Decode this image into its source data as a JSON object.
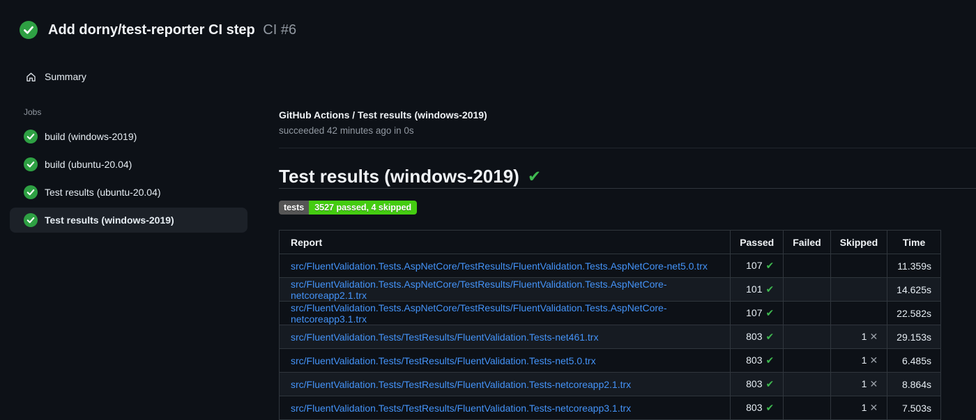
{
  "icons": {
    "check": "✔",
    "cross": "✕"
  },
  "colors": {
    "background": "#0d1117",
    "success_green": "#2ea043",
    "check_green": "#3fb950",
    "link_blue": "#4493f8",
    "muted_text": "#9198a1",
    "badge_label_bg": "#555555",
    "badge_value_bg": "#44cc11",
    "selected_item_bg": "#1c2128",
    "table_border": "#30363d",
    "row_stripe": "#161b22"
  },
  "header": {
    "title": "Add dorny/test-reporter CI step",
    "run_number": "CI #6",
    "status": "success"
  },
  "sidebar": {
    "summary_label": "Summary",
    "jobs_label": "Jobs",
    "jobs": [
      {
        "label": "build (windows-2019)",
        "status": "success",
        "selected": false
      },
      {
        "label": "build (ubuntu-20.04)",
        "status": "success",
        "selected": false
      },
      {
        "label": "Test results (ubuntu-20.04)",
        "status": "success",
        "selected": false
      },
      {
        "label": "Test results (windows-2019)",
        "status": "success",
        "selected": true
      }
    ]
  },
  "main": {
    "check_title": "GitHub Actions / Test results (windows-2019)",
    "check_subtitle": "succeeded 42 minutes ago in 0s",
    "section_title": "Test results (windows-2019)",
    "badge": {
      "label": "tests",
      "message": "3527 passed, 4 skipped"
    },
    "table": {
      "columns": [
        "Report",
        "Passed",
        "Failed",
        "Skipped",
        "Time"
      ],
      "rows": [
        {
          "report": "src/FluentValidation.Tests.AspNetCore/TestResults/FluentValidation.Tests.AspNetCore-net5.0.trx",
          "passed": "107",
          "failed": "",
          "skipped": "",
          "time": "11.359s"
        },
        {
          "report": "src/FluentValidation.Tests.AspNetCore/TestResults/FluentValidation.Tests.AspNetCore-netcoreapp2.1.trx",
          "passed": "101",
          "failed": "",
          "skipped": "",
          "time": "14.625s"
        },
        {
          "report": "src/FluentValidation.Tests.AspNetCore/TestResults/FluentValidation.Tests.AspNetCore-netcoreapp3.1.trx",
          "passed": "107",
          "failed": "",
          "skipped": "",
          "time": "22.582s"
        },
        {
          "report": "src/FluentValidation.Tests/TestResults/FluentValidation.Tests-net461.trx",
          "passed": "803",
          "failed": "",
          "skipped": "1",
          "time": "29.153s"
        },
        {
          "report": "src/FluentValidation.Tests/TestResults/FluentValidation.Tests-net5.0.trx",
          "passed": "803",
          "failed": "",
          "skipped": "1",
          "time": "6.485s"
        },
        {
          "report": "src/FluentValidation.Tests/TestResults/FluentValidation.Tests-netcoreapp2.1.trx",
          "passed": "803",
          "failed": "",
          "skipped": "1",
          "time": "8.864s"
        },
        {
          "report": "src/FluentValidation.Tests/TestResults/FluentValidation.Tests-netcoreapp3.1.trx",
          "passed": "803",
          "failed": "",
          "skipped": "1",
          "time": "7.503s"
        }
      ]
    }
  }
}
